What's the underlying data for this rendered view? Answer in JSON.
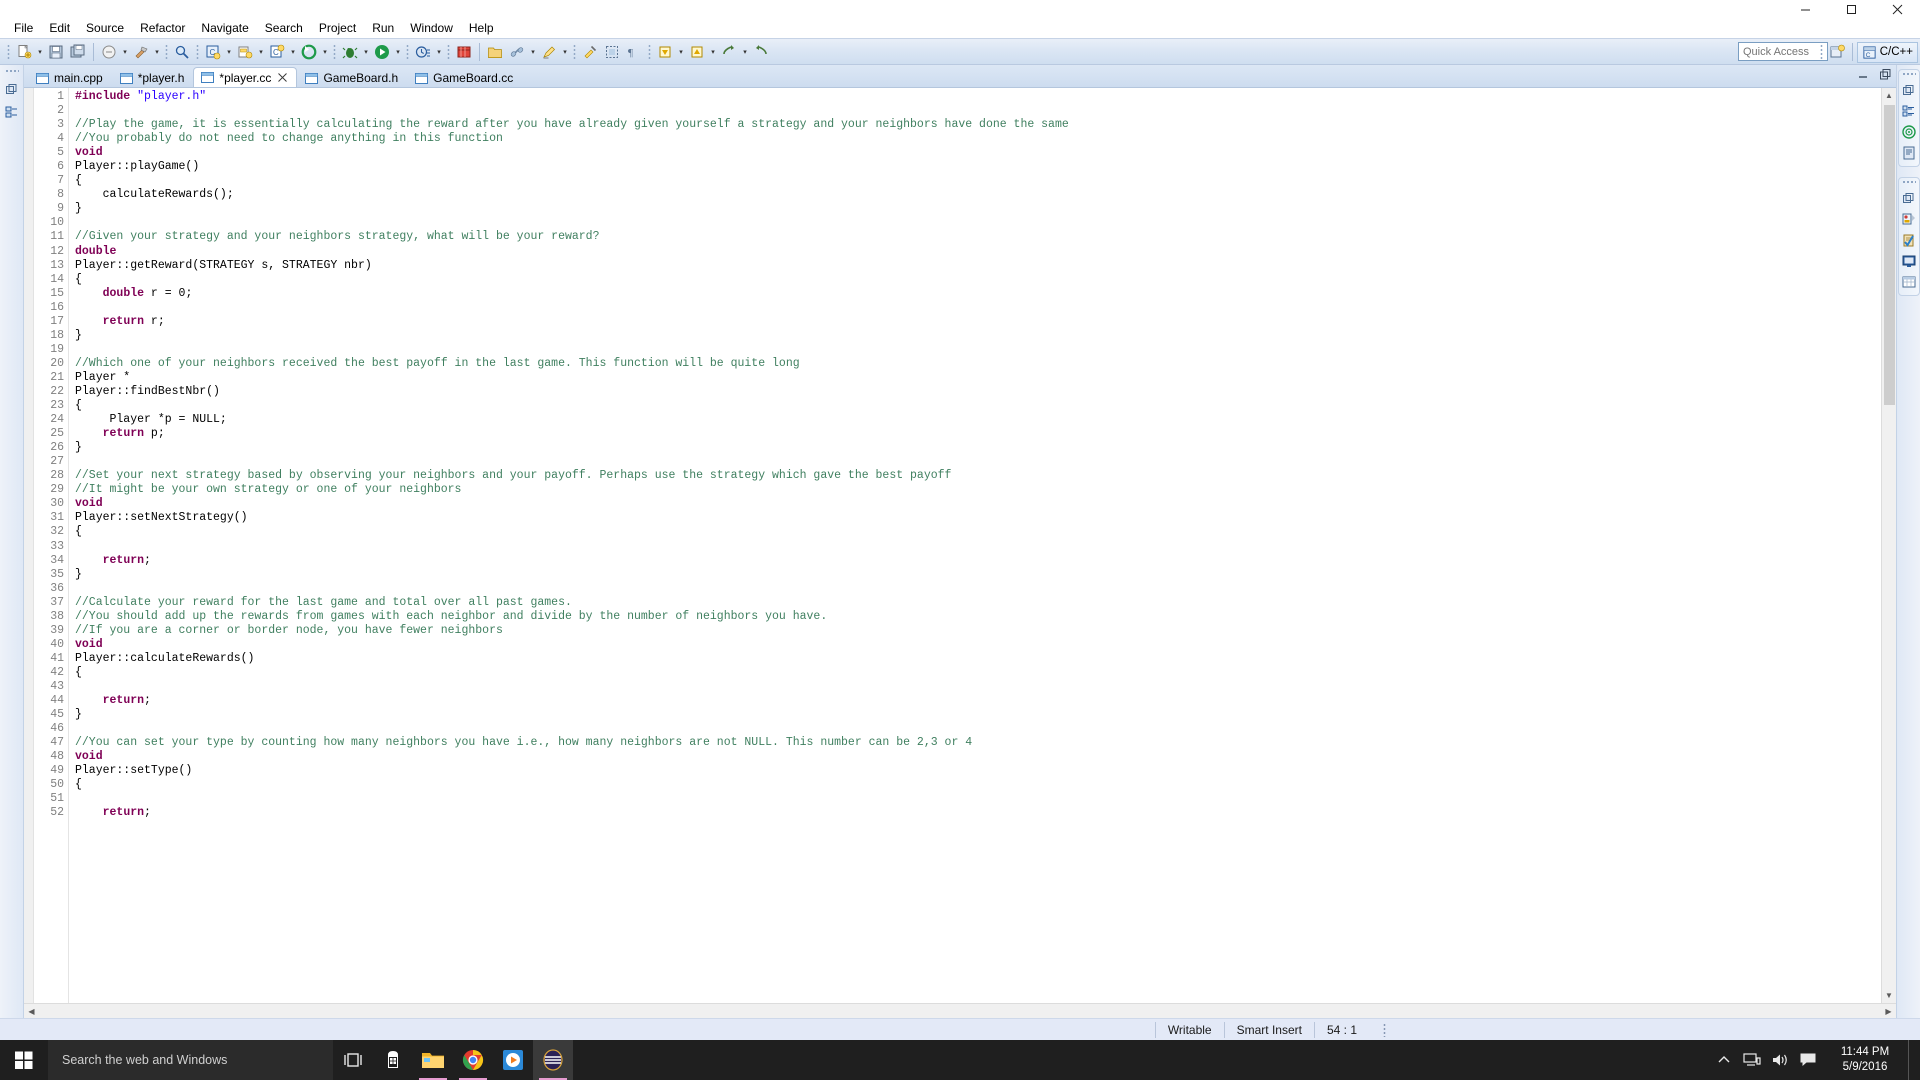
{
  "window": {
    "minimize_label": "Minimize",
    "maximize_label": "Maximize",
    "close_label": "Close"
  },
  "menubar": {
    "items": [
      {
        "label": "File"
      },
      {
        "label": "Edit"
      },
      {
        "label": "Source"
      },
      {
        "label": "Refactor"
      },
      {
        "label": "Navigate"
      },
      {
        "label": "Search"
      },
      {
        "label": "Project"
      },
      {
        "label": "Run"
      },
      {
        "label": "Window"
      },
      {
        "label": "Help"
      }
    ]
  },
  "toolbar": {
    "quick_access_placeholder": "Quick Access",
    "perspective_label": "C/C++"
  },
  "editor": {
    "tabs": [
      {
        "label": "main.cpp",
        "active": false,
        "dirty": false
      },
      {
        "label": "*player.h",
        "active": false,
        "dirty": true
      },
      {
        "label": "*player.cc",
        "active": true,
        "dirty": true
      },
      {
        "label": "GameBoard.h",
        "active": false,
        "dirty": false
      },
      {
        "label": "GameBoard.cc",
        "active": false,
        "dirty": false
      }
    ],
    "first_line": 1,
    "lines": [
      {
        "n": 1,
        "tokens": [
          {
            "t": "#include ",
            "c": "pp"
          },
          {
            "t": "\"player.h\"",
            "c": "str"
          }
        ]
      },
      {
        "n": 2,
        "tokens": []
      },
      {
        "n": 3,
        "tokens": [
          {
            "t": "//Play the game, it is essentially calculating the reward after you have already given yourself a strategy and your neighbors have done the same",
            "c": "cm"
          }
        ]
      },
      {
        "n": 4,
        "tokens": [
          {
            "t": "//You probably do not need to change anything in this function",
            "c": "cm"
          }
        ]
      },
      {
        "n": 5,
        "tokens": [
          {
            "t": "void",
            "c": "kw"
          }
        ]
      },
      {
        "n": 6,
        "tokens": [
          {
            "t": "Player::playGame()",
            "c": "pl"
          }
        ]
      },
      {
        "n": 7,
        "tokens": [
          {
            "t": "{",
            "c": "pl"
          }
        ]
      },
      {
        "n": 8,
        "tokens": [
          {
            "t": "    calculateRewards();",
            "c": "pl"
          }
        ]
      },
      {
        "n": 9,
        "tokens": [
          {
            "t": "}",
            "c": "pl"
          }
        ]
      },
      {
        "n": 10,
        "tokens": []
      },
      {
        "n": 11,
        "tokens": [
          {
            "t": "//Given your strategy and your neighbors strategy, what will be your reward?",
            "c": "cm"
          }
        ]
      },
      {
        "n": 12,
        "tokens": [
          {
            "t": "double",
            "c": "kw"
          }
        ]
      },
      {
        "n": 13,
        "tokens": [
          {
            "t": "Player::getReward(STRATEGY s, STRATEGY nbr)",
            "c": "pl"
          }
        ]
      },
      {
        "n": 14,
        "tokens": [
          {
            "t": "{",
            "c": "pl"
          }
        ]
      },
      {
        "n": 15,
        "tokens": [
          {
            "t": "    ",
            "c": "pl"
          },
          {
            "t": "double",
            "c": "kw"
          },
          {
            "t": " r = 0;",
            "c": "pl"
          }
        ]
      },
      {
        "n": 16,
        "tokens": []
      },
      {
        "n": 17,
        "tokens": [
          {
            "t": "    ",
            "c": "pl"
          },
          {
            "t": "return",
            "c": "kw"
          },
          {
            "t": " r;",
            "c": "pl"
          }
        ]
      },
      {
        "n": 18,
        "tokens": [
          {
            "t": "}",
            "c": "pl"
          }
        ]
      },
      {
        "n": 19,
        "tokens": []
      },
      {
        "n": 20,
        "tokens": [
          {
            "t": "//Which one of your neighbors received the best payoff in the last game. This function will be quite long",
            "c": "cm"
          }
        ]
      },
      {
        "n": 21,
        "tokens": [
          {
            "t": "Player *",
            "c": "pl"
          }
        ]
      },
      {
        "n": 22,
        "tokens": [
          {
            "t": "Player::findBestNbr()",
            "c": "pl"
          }
        ]
      },
      {
        "n": 23,
        "tokens": [
          {
            "t": "{",
            "c": "pl"
          }
        ]
      },
      {
        "n": 24,
        "tokens": [
          {
            "t": "     Player *p = NULL;",
            "c": "pl"
          }
        ]
      },
      {
        "n": 25,
        "tokens": [
          {
            "t": "    ",
            "c": "pl"
          },
          {
            "t": "return",
            "c": "kw"
          },
          {
            "t": " p;",
            "c": "pl"
          }
        ]
      },
      {
        "n": 26,
        "tokens": [
          {
            "t": "}",
            "c": "pl"
          }
        ]
      },
      {
        "n": 27,
        "tokens": []
      },
      {
        "n": 28,
        "tokens": [
          {
            "t": "//Set your next strategy based by observing your neighbors and your payoff. Perhaps use the strategy which gave the best payoff",
            "c": "cm"
          }
        ]
      },
      {
        "n": 29,
        "tokens": [
          {
            "t": "//It might be your own strategy or one of your neighbors",
            "c": "cm"
          }
        ]
      },
      {
        "n": 30,
        "tokens": [
          {
            "t": "void",
            "c": "kw"
          }
        ]
      },
      {
        "n": 31,
        "tokens": [
          {
            "t": "Player::setNextStrategy()",
            "c": "pl"
          }
        ]
      },
      {
        "n": 32,
        "tokens": [
          {
            "t": "{",
            "c": "pl"
          }
        ]
      },
      {
        "n": 33,
        "tokens": []
      },
      {
        "n": 34,
        "tokens": [
          {
            "t": "    ",
            "c": "pl"
          },
          {
            "t": "return",
            "c": "kw"
          },
          {
            "t": ";",
            "c": "pl"
          }
        ]
      },
      {
        "n": 35,
        "tokens": [
          {
            "t": "}",
            "c": "pl"
          }
        ]
      },
      {
        "n": 36,
        "tokens": []
      },
      {
        "n": 37,
        "tokens": [
          {
            "t": "//Calculate your reward for the last game and total over all past games.",
            "c": "cm"
          }
        ]
      },
      {
        "n": 38,
        "tokens": [
          {
            "t": "//You should add up the rewards from games with each neighbor and divide by the number of neighbors you have.",
            "c": "cm"
          }
        ]
      },
      {
        "n": 39,
        "tokens": [
          {
            "t": "//If you are a corner or border node, you have fewer neighbors",
            "c": "cm"
          }
        ]
      },
      {
        "n": 40,
        "tokens": [
          {
            "t": "void",
            "c": "kw"
          }
        ]
      },
      {
        "n": 41,
        "tokens": [
          {
            "t": "Player::calculateRewards()",
            "c": "pl"
          }
        ]
      },
      {
        "n": 42,
        "tokens": [
          {
            "t": "{",
            "c": "pl"
          }
        ]
      },
      {
        "n": 43,
        "tokens": []
      },
      {
        "n": 44,
        "tokens": [
          {
            "t": "    ",
            "c": "pl"
          },
          {
            "t": "return",
            "c": "kw"
          },
          {
            "t": ";",
            "c": "pl"
          }
        ]
      },
      {
        "n": 45,
        "tokens": [
          {
            "t": "}",
            "c": "pl"
          }
        ]
      },
      {
        "n": 46,
        "tokens": []
      },
      {
        "n": 47,
        "tokens": [
          {
            "t": "//You can set your type by counting how many neighbors you have i.e., how many neighbors are not NULL. This number can be 2,3 or 4",
            "c": "cm"
          }
        ]
      },
      {
        "n": 48,
        "tokens": [
          {
            "t": "void",
            "c": "kw"
          }
        ]
      },
      {
        "n": 49,
        "tokens": [
          {
            "t": "Player::setType()",
            "c": "pl"
          }
        ]
      },
      {
        "n": 50,
        "tokens": [
          {
            "t": "{",
            "c": "pl"
          }
        ]
      },
      {
        "n": 51,
        "tokens": []
      },
      {
        "n": 52,
        "tokens": [
          {
            "t": "    ",
            "c": "pl"
          },
          {
            "t": "return",
            "c": "kw"
          },
          {
            "t": ";",
            "c": "pl"
          }
        ]
      }
    ]
  },
  "statusbar": {
    "writable": "Writable",
    "insert_mode": "Smart Insert",
    "cursor_position": "54 : 1"
  },
  "taskbar": {
    "search_placeholder": "Search the web and Windows",
    "time": "11:44 PM",
    "date": "5/9/2016"
  },
  "colors": {
    "comment": "#3f7f5f",
    "keyword": "#7f0055",
    "string": "#2a00ff",
    "toolbar_bg": "#dbe6f4",
    "statusbar_bg": "#e3e9f7",
    "taskbar_bg": "#1f1f1f",
    "tab_active_bg": "#ffffff"
  }
}
